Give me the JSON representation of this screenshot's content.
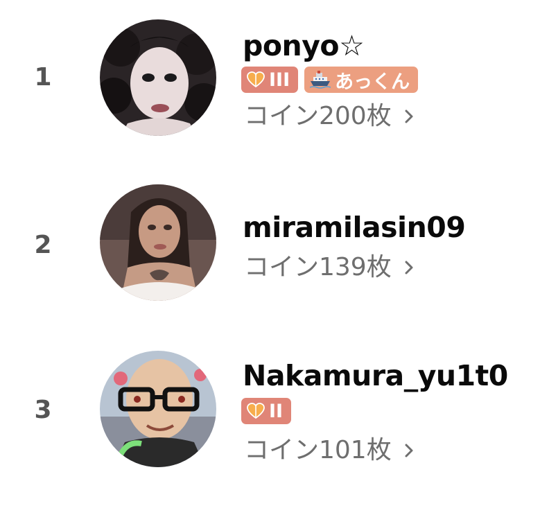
{
  "ranking": [
    {
      "rank": "1",
      "name": "ponyo☆",
      "badges": [
        {
          "type": "level",
          "icon": "heart-icon",
          "label": "III",
          "color": "#e08577"
        },
        {
          "type": "fan-club",
          "icon": "ship-icon",
          "label": "あっくん",
          "color": "#ec9f80"
        }
      ],
      "coins": "コイン200枚"
    },
    {
      "rank": "2",
      "name": "miramilasin09",
      "badges": [],
      "coins": "コイン139枚"
    },
    {
      "rank": "3",
      "name": "Nakamura_yu1t0",
      "badges": [
        {
          "type": "level",
          "icon": "heart-icon",
          "label": "II",
          "color": "#e08577"
        }
      ],
      "coins": "コイン101枚"
    }
  ],
  "icons": {
    "chevron": "chevron-right-icon"
  }
}
